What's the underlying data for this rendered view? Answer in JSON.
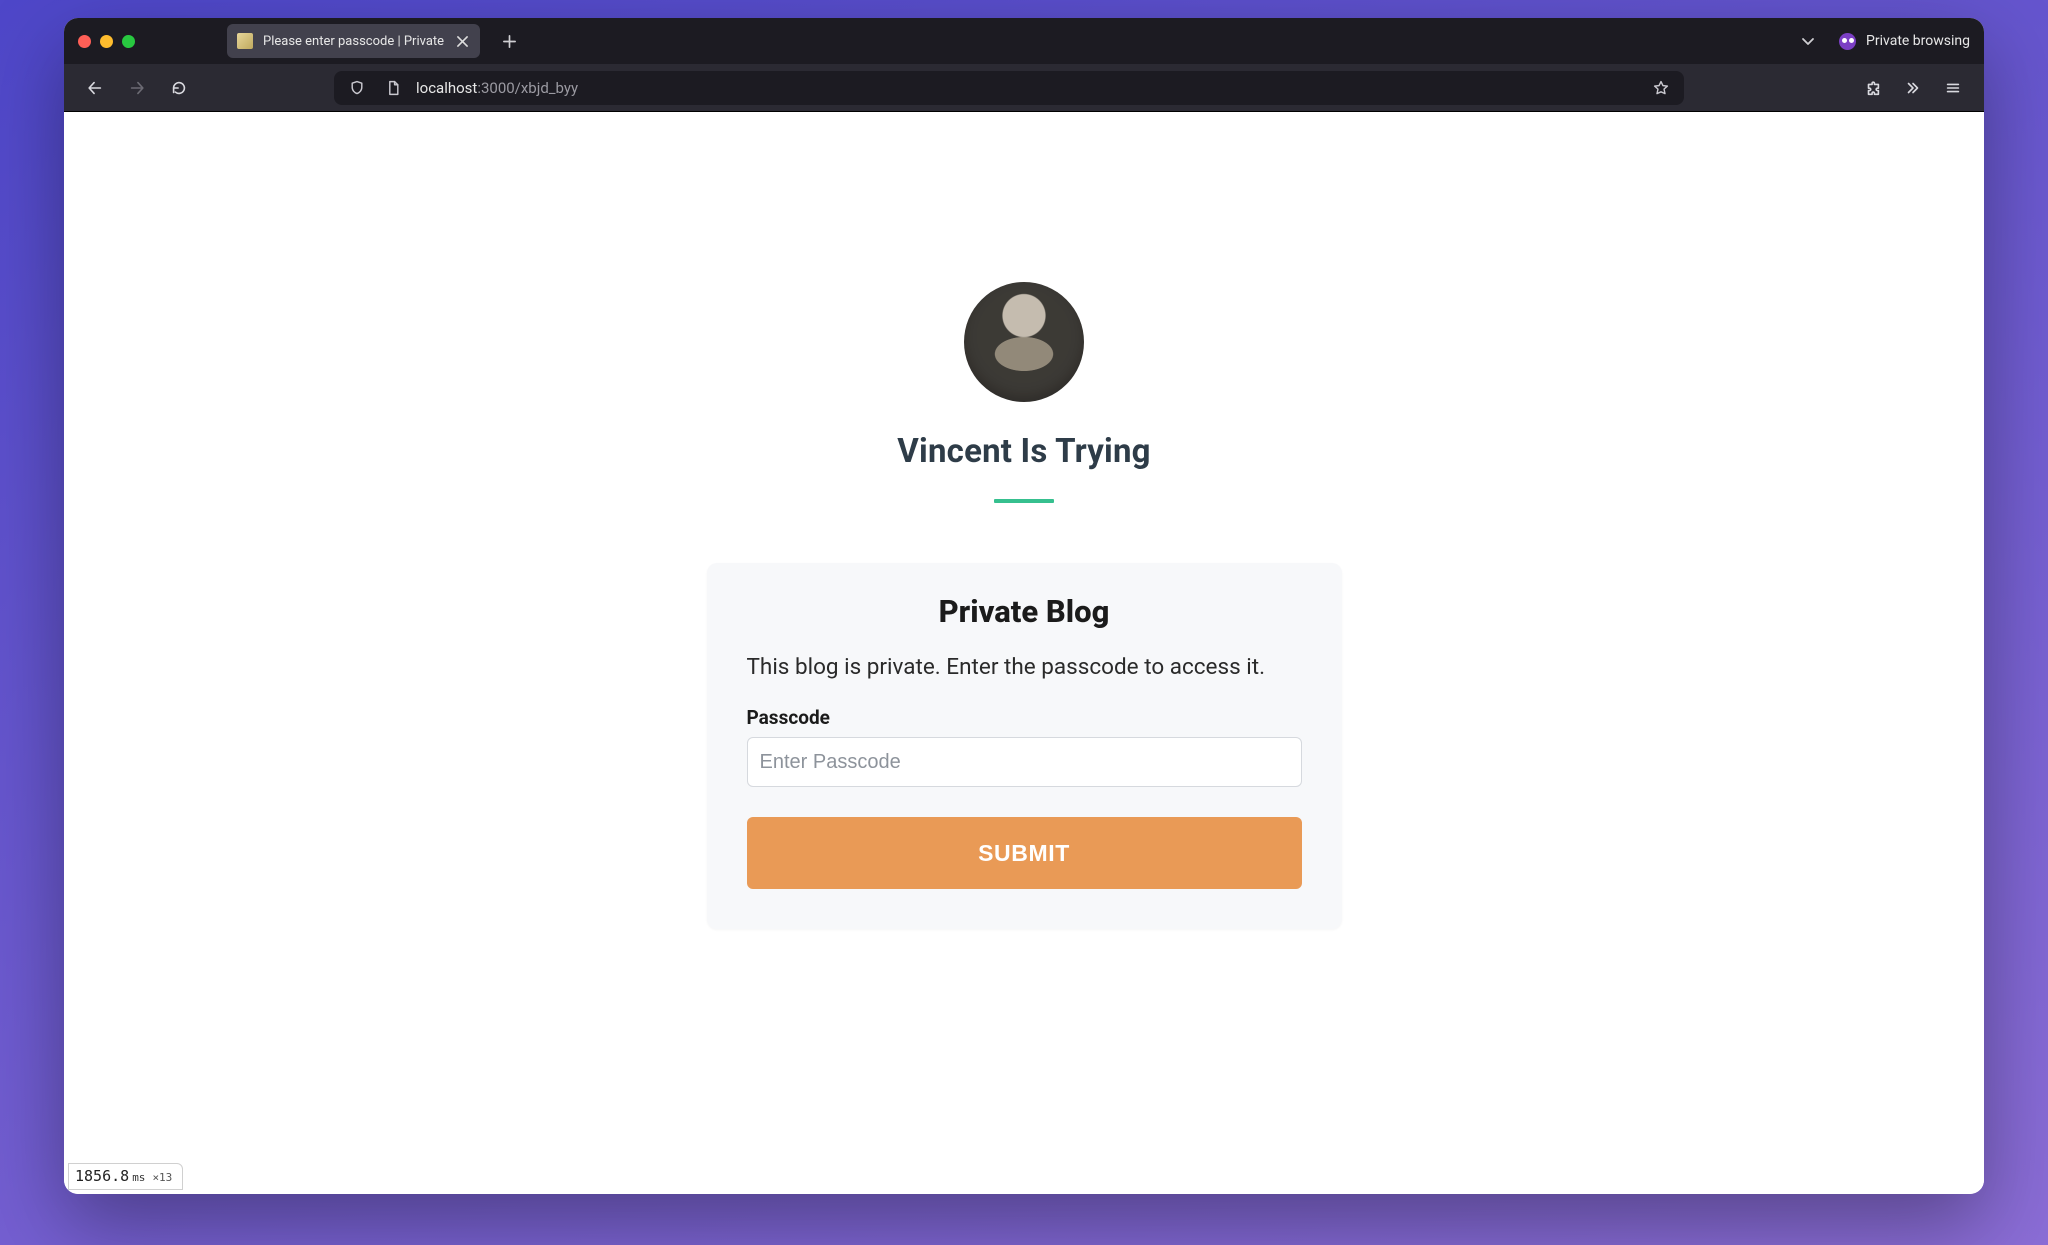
{
  "browser": {
    "tab_title": "Please enter passcode | Private",
    "private_label": "Private browsing",
    "url_host": "localhost",
    "url_port_path": ":3000/xbjd_byy"
  },
  "page": {
    "blog_title": "Vincent Is Trying",
    "card_title": "Private Blog",
    "card_desc": "This blog is private. Enter the passcode to access it.",
    "passcode_label": "Passcode",
    "passcode_placeholder": "Enter Passcode",
    "submit_label": "SUBMIT"
  },
  "perf": {
    "ms": "1856.8",
    "ms_unit": "ms",
    "mult": "×13"
  }
}
